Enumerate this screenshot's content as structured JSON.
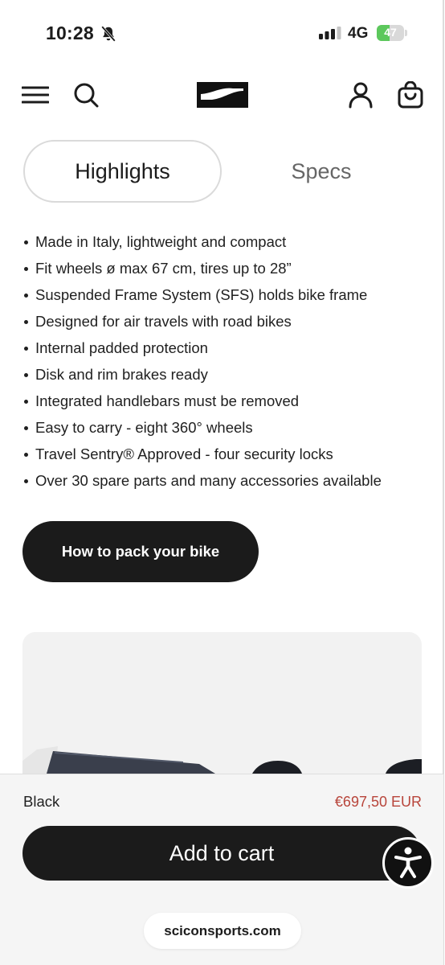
{
  "status_bar": {
    "time": "10:28",
    "network": "4G",
    "battery": "47",
    "battery_level": 0.47,
    "icons": [
      "bell-slash-icon",
      "signal-icon",
      "battery-icon"
    ]
  },
  "header": {
    "icons": [
      "menu-icon",
      "search-icon",
      "brand-logo",
      "account-icon",
      "cart-icon"
    ]
  },
  "tabs": [
    {
      "label": "Highlights",
      "active": true
    },
    {
      "label": "Specs",
      "active": false
    }
  ],
  "highlights": [
    "Made in Italy, lightweight and compact",
    "Fit wheels ø max 67 cm, tires up to 28”",
    "Suspended Frame System (SFS) holds bike frame",
    "Designed for air travels with road bikes",
    "Internal padded protection",
    "Disk and rim brakes ready",
    "Integrated handlebars must be removed",
    "Easy to carry - eight 360° wheels",
    "Travel Sentry® Approved - four security locks",
    "Over 30 spare parts and many accessories available"
  ],
  "how_to_button": "How to pack your bike",
  "purchase_bar": {
    "color": "Black",
    "price": "€697,50 EUR",
    "add_to_cart": "Add to cart"
  },
  "accessibility_icon": "accessibility-icon",
  "browser": {
    "url": "sciconsports.com"
  },
  "colors": {
    "dark": "#1b1b1b",
    "price": "#b8453b",
    "battery": "#5cc85c"
  }
}
